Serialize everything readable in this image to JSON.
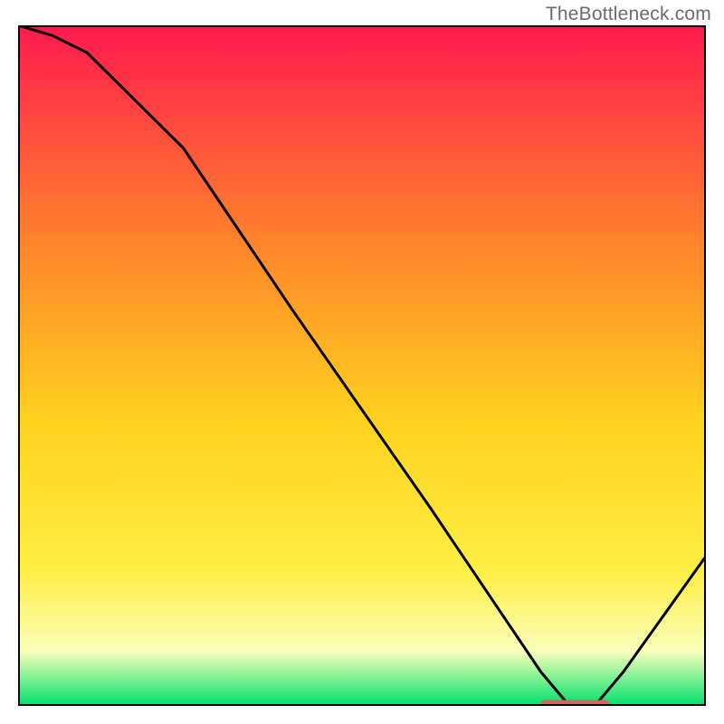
{
  "watermark": "TheBottleneck.com",
  "colors": {
    "gradient_top": "#ff1a4d",
    "gradient_mid_upper": "#ff8a2a",
    "gradient_mid": "#ffd21f",
    "gradient_mid_lower": "#ffee44",
    "gradient_haze": "#f9ffbb",
    "gradient_bottom": "#00e06b",
    "curve": "#000000",
    "marker": "#c96a5e",
    "frame": "#000000"
  },
  "chart_data": {
    "type": "line",
    "title": "",
    "xlabel": "",
    "ylabel": "",
    "x": [
      0,
      5,
      10,
      24,
      30,
      40,
      50,
      60,
      70,
      76,
      80,
      84,
      88,
      100
    ],
    "values": [
      100,
      98.5,
      96,
      82,
      73,
      58,
      43.5,
      29,
      14,
      5,
      0.2,
      0.2,
      5,
      22
    ],
    "xlim": [
      0,
      100
    ],
    "ylim": [
      0,
      100
    ],
    "marker_band": {
      "x_start": 76,
      "x_end": 86,
      "y": 0.2
    }
  }
}
